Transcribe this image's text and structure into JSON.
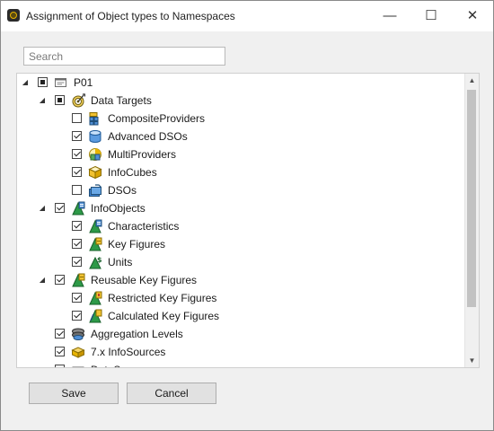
{
  "window": {
    "title": "Assignment of Object types to Namespaces",
    "controls": [
      "—",
      "☐",
      "✕"
    ]
  },
  "search": {
    "placeholder": "Search",
    "value": ""
  },
  "tree": {
    "rows": [
      {
        "label": "P01",
        "level": 0,
        "expanded": true,
        "state": "partial",
        "icon": "system-icon"
      },
      {
        "label": "Data Targets",
        "level": 1,
        "expanded": true,
        "state": "partial",
        "icon": "data-targets-icon"
      },
      {
        "label": "CompositeProviders",
        "level": 2,
        "state": "unchecked",
        "icon": "composite-provider-icon"
      },
      {
        "label": "Advanced DSOs",
        "level": 2,
        "state": "checked",
        "icon": "advanced-dso-icon"
      },
      {
        "label": "MultiProviders",
        "level": 2,
        "state": "checked",
        "icon": "multiprovider-icon"
      },
      {
        "label": "InfoCubes",
        "level": 2,
        "state": "checked",
        "icon": "infocube-icon"
      },
      {
        "label": "DSOs",
        "level": 2,
        "state": "unchecked",
        "icon": "dso-icon"
      },
      {
        "label": "InfoObjects",
        "level": 1,
        "expanded": true,
        "state": "checked",
        "icon": "infoobjects-icon"
      },
      {
        "label": "Characteristics",
        "level": 2,
        "state": "checked",
        "icon": "characteristics-icon"
      },
      {
        "label": "Key Figures",
        "level": 2,
        "state": "checked",
        "icon": "key-figures-icon"
      },
      {
        "label": "Units",
        "level": 2,
        "state": "checked",
        "icon": "units-icon"
      },
      {
        "label": "Reusable Key Figures",
        "level": 1,
        "expanded": true,
        "state": "checked",
        "icon": "reusable-key-figures-icon"
      },
      {
        "label": "Restricted Key Figures",
        "level": 2,
        "state": "checked",
        "icon": "restricted-key-figures-icon"
      },
      {
        "label": "Calculated Key Figures",
        "level": 2,
        "state": "checked",
        "icon": "calculated-key-figures-icon"
      },
      {
        "label": "Aggregation Levels",
        "level": 1,
        "state": "checked",
        "icon": "aggregation-levels-icon"
      },
      {
        "label": "7.x InfoSources",
        "level": 1,
        "state": "checked",
        "icon": "infosources-icon"
      },
      {
        "label": "DataSources",
        "level": 1,
        "state": "checked",
        "icon": "datasources-icon"
      }
    ]
  },
  "buttons": {
    "save": "Save",
    "cancel": "Cancel"
  },
  "colors": {
    "window_bg": "#f0f0f0",
    "tree_bg": "#ffffff",
    "button_bg": "#e1e1e1",
    "button_border": "#adadad"
  }
}
